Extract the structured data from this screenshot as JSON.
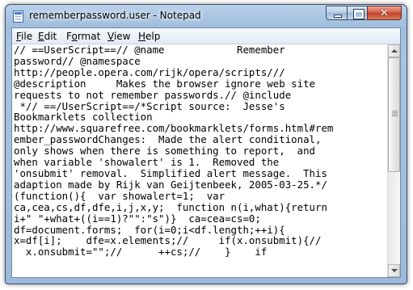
{
  "window": {
    "title": "rememberpassword.user - Notepad",
    "icon": "notepad-icon",
    "close_glyph": "✕"
  },
  "menu": {
    "items": [
      {
        "label_underline": "F",
        "label_rest": "ile"
      },
      {
        "label_underline": "E",
        "label_rest": "dit"
      },
      {
        "label_pre": "F",
        "label_underline": "o",
        "label_rest": "rmat"
      },
      {
        "label_underline": "V",
        "label_rest": "iew"
      },
      {
        "label_underline": "H",
        "label_rest": "elp"
      }
    ]
  },
  "editor": {
    "lines": [
      "// ==UserScript==// @name            Remember",
      "password// @namespace",
      "http://people.opera.com/rijk/opera/scripts///",
      "@description     Makes the browser ignore web site",
      "requests to not remember passwords.// @include",
      " *// ==/UserScript==/*Script source:  Jesse's",
      "Bookmarklets collection",
      "http://www.squarefree.com/bookmarklets/forms.html#rem",
      "ember_passwordChanges:  Made the alert conditional,",
      "only shows when there is something to report,  and",
      "when variable 'showalert' is 1.  Removed the",
      "'onsubmit' removal.  Simplified alert message.  This",
      "adaption made by Rijk van Geijtenbeek, 2005-03-25.*/",
      "(function(){  var showalert=1;  var",
      "ca,cea,cs,df,dfe,i,j,x,y;  function n(i,what){return",
      "i+\" \"+what+((i==1)?\"\":\"s\")}  ca=cea=cs=0;",
      "df=document.forms;  for(i=0;i<df.length;++i){",
      "x=df[i];    dfe=x.elements;//     if(x.onsubmit){//",
      "  x.onsubmit=\"\";//      ++cs;//    }    if"
    ]
  }
}
